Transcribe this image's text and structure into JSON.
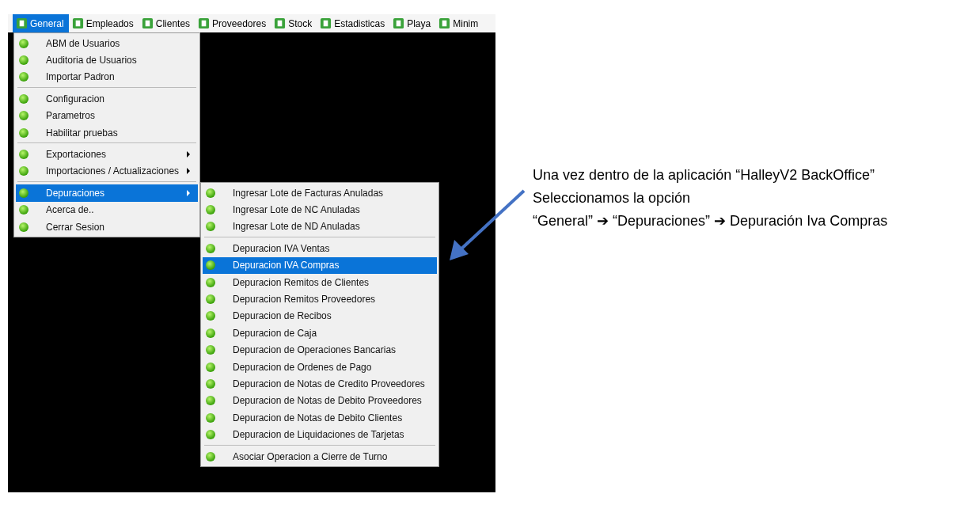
{
  "menubar": {
    "items": [
      {
        "label": "General",
        "selected": true
      },
      {
        "label": "Empleados",
        "selected": false
      },
      {
        "label": "Clientes",
        "selected": false
      },
      {
        "label": "Proveedores",
        "selected": false
      },
      {
        "label": "Stock",
        "selected": false
      },
      {
        "label": "Estadisticas",
        "selected": false
      },
      {
        "label": "Playa",
        "selected": false
      },
      {
        "label": "Minim",
        "selected": false
      }
    ]
  },
  "general_menu": {
    "groups": [
      [
        {
          "label": "ABM de Usuarios",
          "selected": false,
          "submenu": false
        },
        {
          "label": "Auditoria de Usuarios",
          "selected": false,
          "submenu": false
        },
        {
          "label": "Importar Padron",
          "selected": false,
          "submenu": false
        }
      ],
      [
        {
          "label": "Configuracion",
          "selected": false,
          "submenu": false
        },
        {
          "label": "Parametros",
          "selected": false,
          "submenu": false
        },
        {
          "label": "Habilitar pruebas",
          "selected": false,
          "submenu": false
        }
      ],
      [
        {
          "label": "Exportaciones",
          "selected": false,
          "submenu": true
        },
        {
          "label": "Importaciones / Actualizaciones",
          "selected": false,
          "submenu": true
        }
      ],
      [
        {
          "label": "Depuraciones",
          "selected": true,
          "submenu": true
        },
        {
          "label": "Acerca de..",
          "selected": false,
          "submenu": false
        },
        {
          "label": "Cerrar Sesion",
          "selected": false,
          "submenu": false
        }
      ]
    ]
  },
  "depuraciones_submenu": {
    "groups": [
      [
        {
          "label": "Ingresar Lote de Facturas Anuladas",
          "selected": false
        },
        {
          "label": "Ingresar Lote de NC Anuladas",
          "selected": false
        },
        {
          "label": "Ingresar Lote de ND Anuladas",
          "selected": false
        }
      ],
      [
        {
          "label": "Depuracion IVA Ventas",
          "selected": false
        },
        {
          "label": "Depuracion IVA Compras",
          "selected": true
        },
        {
          "label": "Depuracion Remitos de Clientes",
          "selected": false
        },
        {
          "label": "Depuracion Remitos Proveedores",
          "selected": false
        },
        {
          "label": "Depuracion de Recibos",
          "selected": false
        },
        {
          "label": "Depuracion de Caja",
          "selected": false
        },
        {
          "label": "Depuracion de Operaciones Bancarias",
          "selected": false
        },
        {
          "label": "Depuracion de Ordenes de Pago",
          "selected": false
        },
        {
          "label": "Depuracion de Notas de Credito Proveedores",
          "selected": false
        },
        {
          "label": "Depuracion de Notas de Debito Proveedores",
          "selected": false
        },
        {
          "label": "Depuracion de Notas de Debito Clientes",
          "selected": false
        },
        {
          "label": "Depuracion de Liquidaciones de Tarjetas",
          "selected": false
        }
      ],
      [
        {
          "label": "Asociar Operacion a Cierre de Turno",
          "selected": false
        }
      ]
    ]
  },
  "annotation": {
    "lines": [
      "Una vez dentro de la aplicación “HalleyV2 BackOffice”",
      "Seleccionamos la opción",
      "“General” ➔ “Depuraciones” ➔ Depuración Iva Compras"
    ]
  }
}
